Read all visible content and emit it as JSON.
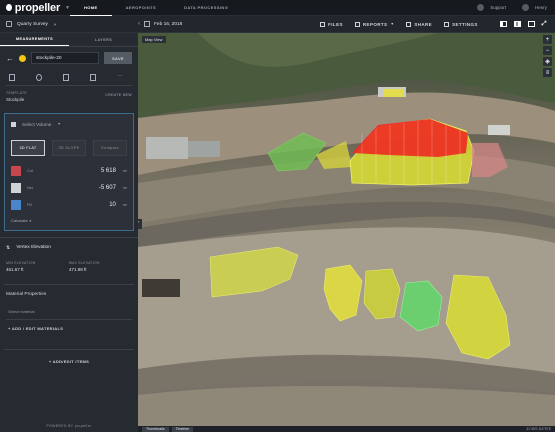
{
  "topbar": {
    "brand": "propeller",
    "nav": [
      "HOME",
      "AEROPOINTS",
      "DATA PROCESSING"
    ],
    "support": "Support",
    "user": "Henry"
  },
  "subbar": {
    "site": "Quarry Survey",
    "date": "Feb 16, 2018",
    "tools": [
      "FILES",
      "REPORTS",
      "SHARE",
      "SETTINGS"
    ]
  },
  "sidebar": {
    "tabs": [
      "MEASUREMENTS",
      "LAYERS"
    ],
    "name_value": "stockpile-20",
    "save_label": "SAVE",
    "template_label": "TEMPLATE",
    "template_value": "Stockpile",
    "create_new": "CREATE NEW",
    "volume": {
      "title": "Select Volume",
      "buttons": [
        "3D FLAT",
        "3D SLOPE",
        "Compare"
      ],
      "rows": [
        {
          "label": "Cut",
          "value": "5 618",
          "unit": "m³",
          "color": "#c8474e"
        },
        {
          "label": "Net",
          "value": "-5 607",
          "unit": "m³",
          "color": "#cfd2d6"
        },
        {
          "label": "Fill",
          "value": "10",
          "unit": "m³",
          "color": "#4a84c9"
        }
      ],
      "calculate": "Calculate"
    },
    "elevation": {
      "title": "Vertex Elevation",
      "min_label": "MIN ELEVATION",
      "min_value": "461.67 ft",
      "max_label": "MAX ELEVATION",
      "max_value": "471.98 ft"
    },
    "material": {
      "title": "Material Properties",
      "select": "Select material",
      "add": "+ ADD / EDIT MATERIALS"
    },
    "add_items": "+ ADD/EDIT ITEMS",
    "powered": "POWERED BY propeller"
  },
  "map": {
    "view_label": "Map View",
    "bottom_tabs": [
      "Thumbnails",
      "Timeline"
    ],
    "coords": "31°45'S 115°57'E"
  }
}
